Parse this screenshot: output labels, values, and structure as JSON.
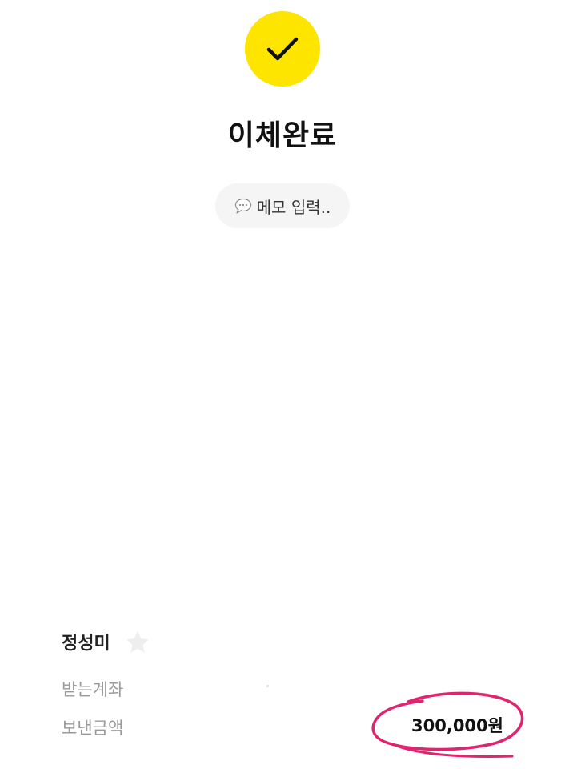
{
  "status": {
    "icon": "checkmark-icon",
    "title": "이체완료",
    "accent_color": "#FEE500"
  },
  "memo": {
    "icon": "speech-bubble-icon",
    "label": "메모 입력.."
  },
  "recipient": {
    "name": "정성미",
    "favorite_icon": "star-icon"
  },
  "details": {
    "account_label": "받는계좌",
    "amount_label": "보낸금액",
    "amount_value": "300,000원"
  },
  "annotation": {
    "icon": "hand-drawn-circle",
    "color": "#E0246E"
  }
}
